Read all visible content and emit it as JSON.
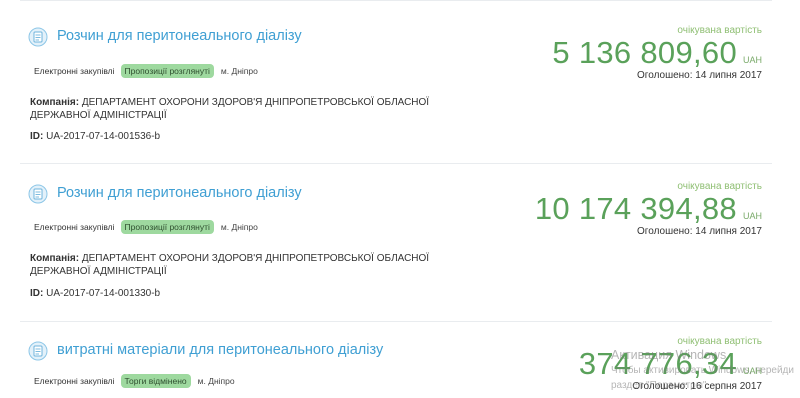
{
  "tenders": [
    {
      "title": "Розчин для перитонеального діалізу",
      "procurement_type": "Електронні закупівлі",
      "status": "Пропозиції розглянуті",
      "city": "м. Дніпро",
      "company_label": "Компанія:",
      "company": "ДЕПАРТАМЕНТ ОХОРОНИ ЗДОРОВ'Я ДНІПРОПЕТРОВСЬКОЇ ОБЛАСНОЇ ДЕРЖАВНОЇ АДМІНІСТРАЦІЇ",
      "id_label": "ID:",
      "id": "UA-2017-07-14-001536-b",
      "expected_label": "очікувана вартість",
      "amount": "5 136 809,60",
      "currency": "UAH",
      "announced": "Оголошено: 14 липня 2017"
    },
    {
      "title": "Розчин для перитонеального діалізу",
      "procurement_type": "Електронні закупівлі",
      "status": "Пропозиції розглянуті",
      "city": "м. Дніпро",
      "company_label": "Компанія:",
      "company": "ДЕПАРТАМЕНТ ОХОРОНИ ЗДОРОВ'Я ДНІПРОПЕТРОВСЬКОЇ ОБЛАСНОЇ ДЕРЖАВНОЇ АДМІНІСТРАЦІЇ",
      "id_label": "ID:",
      "id": "UA-2017-07-14-001330-b",
      "expected_label": "очікувана вартість",
      "amount": "10 174 394,88",
      "currency": "UAH",
      "announced": "Оголошено: 14 липня 2017"
    },
    {
      "title": "витратні матеріали для перитонеального діалізу",
      "procurement_type": "Електронні закупівлі",
      "status": "Торги відмінено",
      "city": "м. Дніпро",
      "expected_label": "очікувана вартість",
      "amount": "374 776,34",
      "currency": "UAH",
      "announced": "Оголошено: 16 серпня 2017"
    }
  ],
  "watermark": {
    "line1": "Активация Windows",
    "line2": "Чтобы активировать Windows, перейди",
    "line3": "раздел \"Параметры\"."
  },
  "colors": {
    "title_link": "#3f9fd3",
    "amount": "#5aa15a",
    "status_badge": "#9ed99f",
    "divider": "#e9ecef"
  },
  "icons": [
    "tender-document-icon"
  ]
}
